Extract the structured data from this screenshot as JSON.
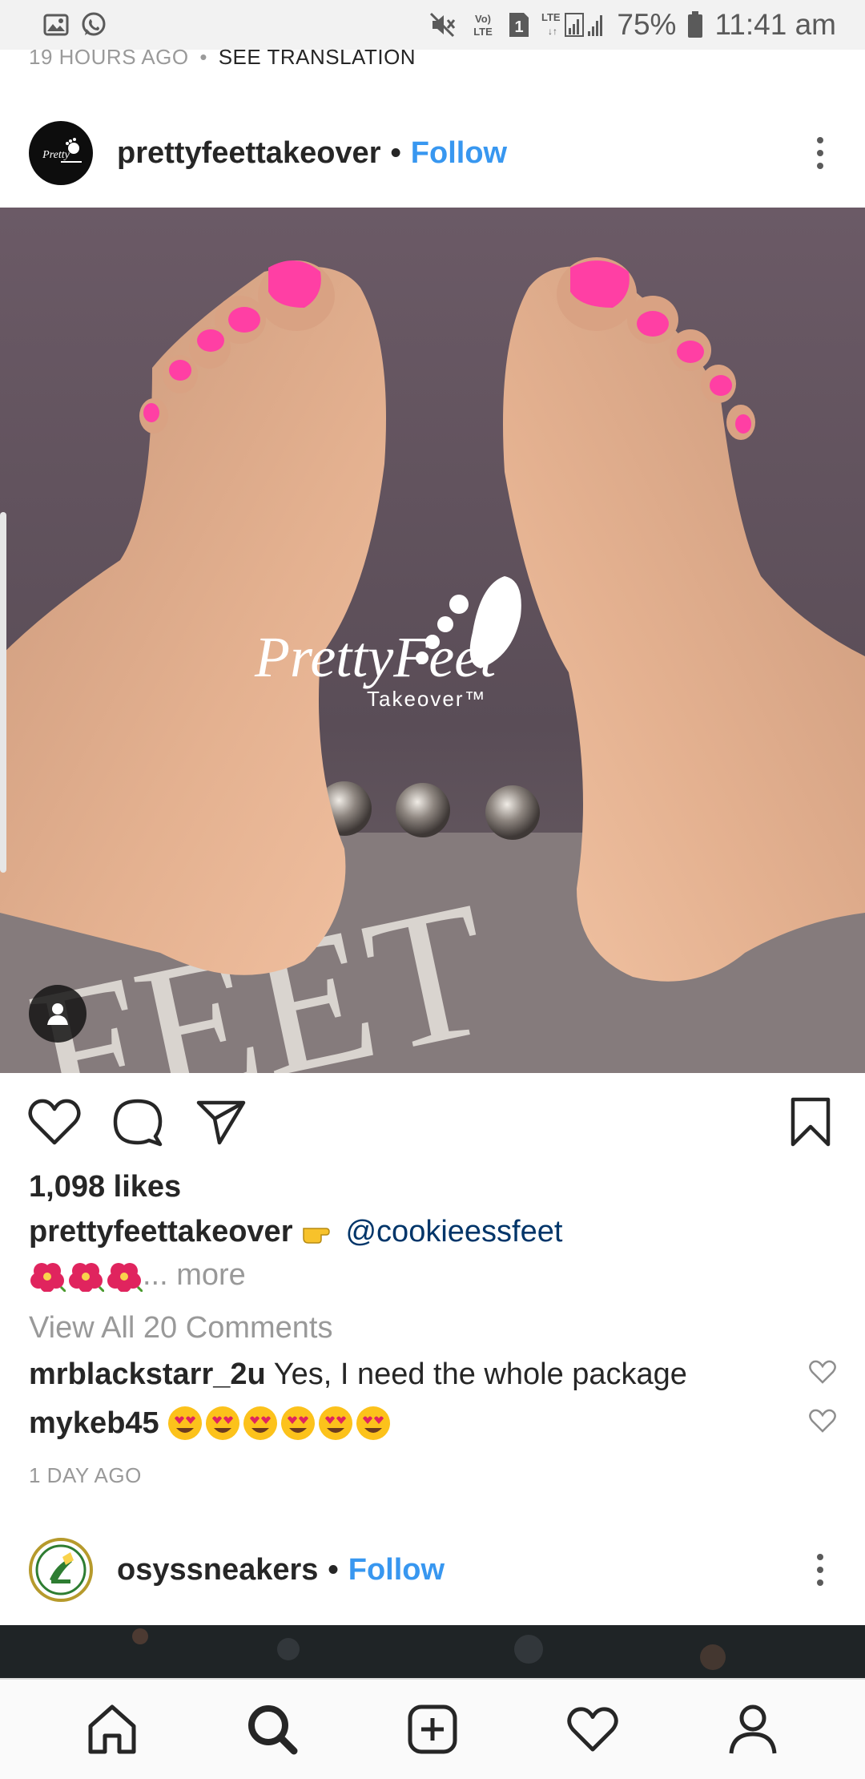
{
  "status_bar": {
    "battery": "75%",
    "time": "11:41 am",
    "sim_slot": "1",
    "network_type": "LTE",
    "volte_label": "VoLTE"
  },
  "previous_post": {
    "time_ago": "19 HOURS AGO",
    "separator": "•",
    "translate_label": "SEE TRANSLATION"
  },
  "post": {
    "username": "prettyfeettakeover",
    "separator": "•",
    "follow_label": "Follow",
    "image_watermark": {
      "brand": "PrettyFeet",
      "tagline": "Takeover™"
    },
    "likes": "1,098 likes",
    "caption_user": "prettyfeettakeover",
    "caption_mention": "@cookieessfeet",
    "caption_more": "... more",
    "view_all_comments": "View All 20 Comments",
    "comments": [
      {
        "user": "mrblackstarr_2u",
        "text": "Yes, I need the whole package"
      },
      {
        "user": "mykeb45",
        "text": ""
      }
    ],
    "time_ago": "1 DAY AGO"
  },
  "next_post": {
    "username": "osyssneakers",
    "separator": "•",
    "follow_label": "Follow"
  },
  "icons": {
    "like": "heart-icon",
    "comment": "comment-icon",
    "share": "send-icon",
    "save": "bookmark-icon",
    "nav": [
      "home-icon",
      "search-icon",
      "add-post-icon",
      "activity-heart-icon",
      "profile-icon"
    ]
  },
  "colors": {
    "accent_blue": "#3897f0",
    "mention_blue": "#003569",
    "muted_gray": "#999999",
    "nail_pink": "#ff3fa4"
  }
}
